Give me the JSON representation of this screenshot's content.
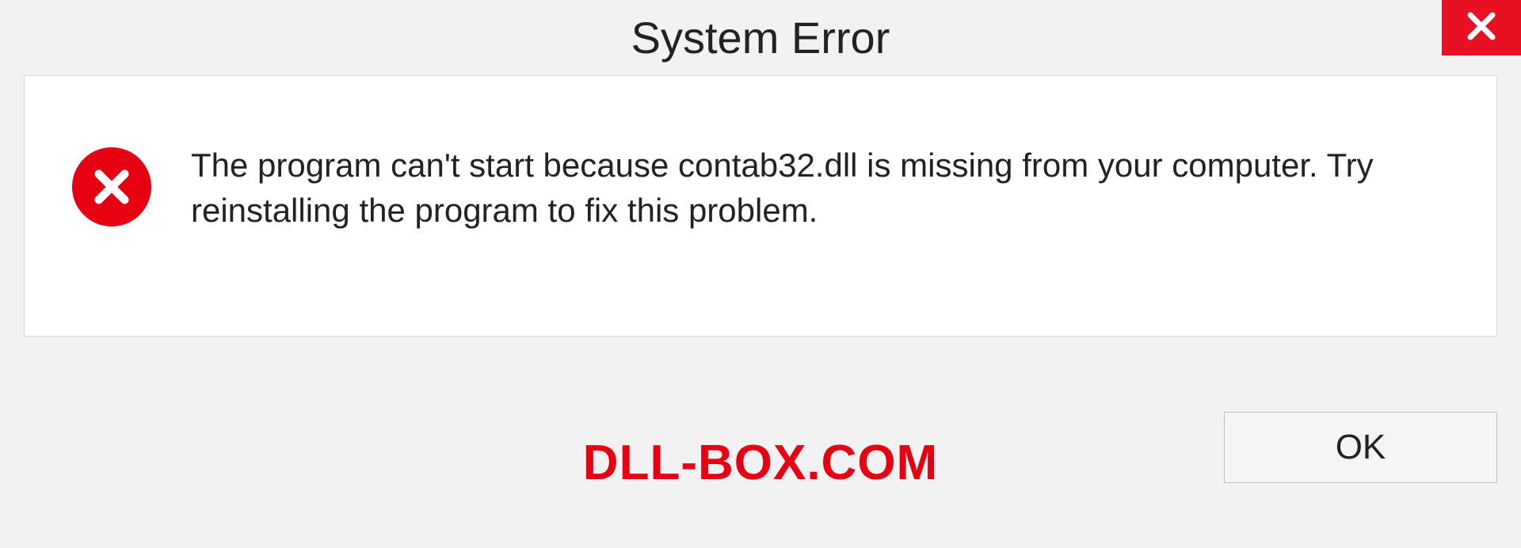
{
  "titlebar": {
    "title": "System Error"
  },
  "content": {
    "message": "The program can't start because contab32.dll is missing from your computer. Try reinstalling the program to fix this problem."
  },
  "footer": {
    "watermark": "DLL-BOX.COM",
    "ok_label": "OK"
  }
}
